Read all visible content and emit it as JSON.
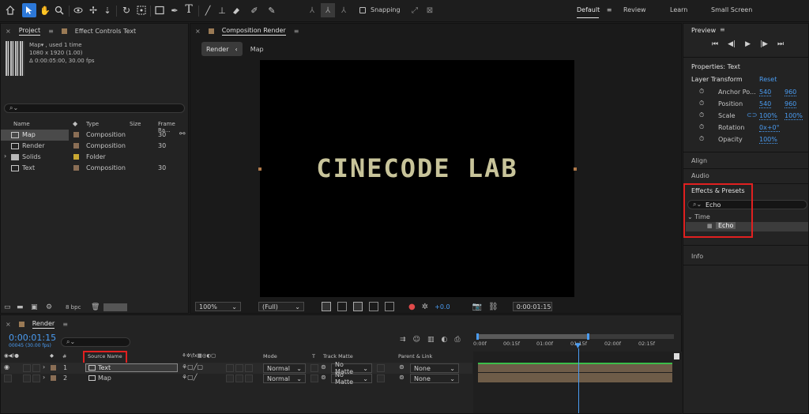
{
  "toolbar": {
    "snapping_label": "Snapping",
    "workspaces": [
      "Default",
      "Review",
      "Learn",
      "Small Screen"
    ]
  },
  "project_panel": {
    "tabs": [
      "Project",
      "Effect Controls Text"
    ],
    "asset_name": "Map",
    "asset_used": ", used 1 time",
    "asset_dims": "1080 x 1920 (1.00)",
    "asset_duration": "Δ 0:00:05:00, 30.00 fps",
    "search_placeholder": "",
    "columns": [
      "Name",
      "Type",
      "Size",
      "Frame Ra..."
    ],
    "items": [
      {
        "name": "Map",
        "type": "Composition",
        "size": "",
        "fps": "30"
      },
      {
        "name": "Render",
        "type": "Composition",
        "size": "",
        "fps": "30"
      },
      {
        "name": "Solids",
        "type": "Folder",
        "size": "",
        "fps": ""
      },
      {
        "name": "Text",
        "type": "Composition",
        "size": "",
        "fps": "30"
      }
    ],
    "bpc_label": "8 bpc"
  },
  "composition_panel": {
    "title": "Composition Render",
    "breadcrumbs": [
      "Render",
      "Map"
    ],
    "canvas_text": "CINECODE LAB",
    "zoom": "100%",
    "resolution": "(Full)",
    "exposure": "+0.0",
    "timecode": "0:00:01:15"
  },
  "right_panel": {
    "preview_title": "Preview",
    "properties_title": "Properties: Text",
    "layer_transform": "Layer Transform",
    "reset_label": "Reset",
    "props": [
      {
        "name": "Anchor Po...",
        "v1": "540",
        "v2": "960"
      },
      {
        "name": "Position",
        "v1": "540",
        "v2": "960"
      },
      {
        "name": "Scale",
        "v1": "100%",
        "v2": "100%"
      },
      {
        "name": "Rotation",
        "v1": "0x+0°",
        "v2": ""
      },
      {
        "name": "Opacity",
        "v1": "100%",
        "v2": ""
      }
    ],
    "align_label": "Align",
    "audio_label": "Audio",
    "effects_title": "Effects & Presets",
    "effects_search": "Echo",
    "effects_group": "Time",
    "effects_item": "Echo",
    "info_label": "Info"
  },
  "timeline": {
    "comp_name": "Render",
    "timecode": "0:00:01:15",
    "frame_info": "00045 (30.00 fps)",
    "columns": {
      "source": "Source Name",
      "mode": "Mode",
      "t": "T",
      "track_matte": "Track Matte",
      "parent": "Parent & Link"
    },
    "ruler": [
      "0:00f",
      "00:15f",
      "01:00f",
      "01:15f",
      "02:00f",
      "02:15f"
    ],
    "layers": [
      {
        "num": "1",
        "name": "Text",
        "mode": "Normal",
        "matte": "No Matte",
        "parent": "None"
      },
      {
        "num": "2",
        "name": "Map",
        "mode": "Normal",
        "matte": "No Matte",
        "parent": "None"
      }
    ]
  }
}
